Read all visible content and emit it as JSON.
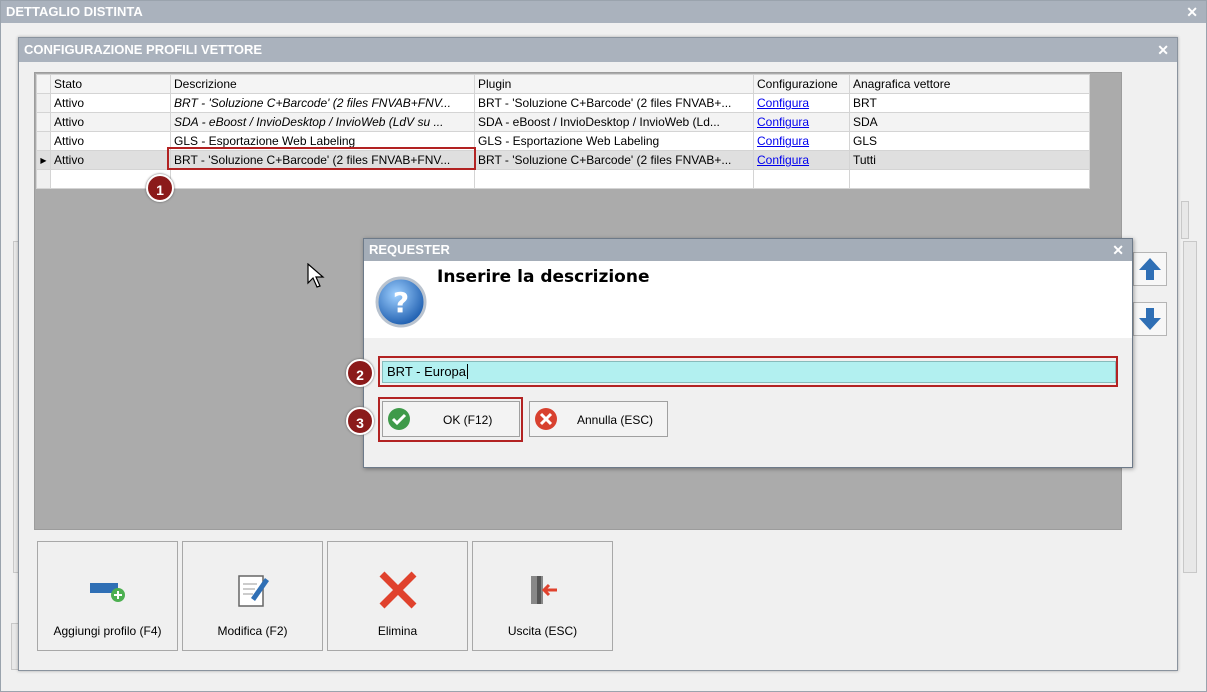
{
  "outer": {
    "title": "DETTAGLIO DISTINTA"
  },
  "dialog": {
    "title": "CONFIGURAZIONE PROFILI VETTORE"
  },
  "grid": {
    "columns": [
      "Stato",
      "Descrizione",
      "Plugin",
      "Configurazione",
      "Anagrafica vettore"
    ],
    "rows": [
      {
        "stato": "Attivo",
        "descrizione": "BRT - 'Soluzione C+Barcode' (2 files FNVAB+FNV...",
        "plugin": "BRT - 'Soluzione C+Barcode' (2 files FNVAB+...",
        "configurazione": "Configura",
        "anagrafica": "BRT"
      },
      {
        "stato": "Attivo",
        "descrizione": "SDA - eBoost / InvioDesktop / InvioWeb (LdV su ...",
        "plugin": "SDA - eBoost / InvioDesktop / InvioWeb (Ld...",
        "configurazione": "Configura",
        "anagrafica": "SDA"
      },
      {
        "stato": "Attivo",
        "descrizione": "GLS - Esportazione Web Labeling",
        "plugin": "GLS - Esportazione Web Labeling",
        "configurazione": "Configura",
        "anagrafica": "GLS"
      },
      {
        "stato": "Attivo",
        "descrizione": "BRT - 'Soluzione C+Barcode' (2 files FNVAB+FNV...",
        "plugin": "BRT - 'Soluzione C+Barcode' (2 files FNVAB+...",
        "configurazione": "Configura",
        "anagrafica": "Tutti"
      }
    ]
  },
  "markers": {
    "m1": "1",
    "m2": "2",
    "m3": "3"
  },
  "buttons": {
    "add": "Aggiungi profilo (F4)",
    "edit": "Modifica (F2)",
    "delete": "Elimina",
    "exit": "Uscita (ESC)"
  },
  "requester": {
    "title": "REQUESTER",
    "prompt": "Inserire la descrizione",
    "input_value": "BRT - Europa",
    "ok_label": "OK (F12)",
    "cancel_label": "Annulla (ESC)"
  },
  "colors": {
    "titlebar": "#aab2bd",
    "marker": "#8b1a1a",
    "input_bg": "#b2f0f0",
    "highlight": "#b22222"
  }
}
